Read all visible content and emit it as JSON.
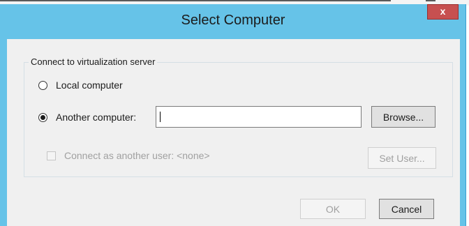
{
  "window": {
    "title": "Select Computer",
    "close_glyph": "x"
  },
  "group": {
    "label": "Connect to virtualization server"
  },
  "options": {
    "local_label": "Local computer",
    "another_label": "Another computer:",
    "selected": "another"
  },
  "computer_input": {
    "value": ""
  },
  "buttons": {
    "browse": "Browse...",
    "set_user": "Set User...",
    "ok": "OK",
    "cancel": "Cancel"
  },
  "connect_as": {
    "label": "Connect as another user: <none>",
    "checked": false,
    "enabled": false
  },
  "colors": {
    "title_bar": "#66c3e8",
    "close_button": "#c75050",
    "client_bg": "#f0f0f0"
  }
}
